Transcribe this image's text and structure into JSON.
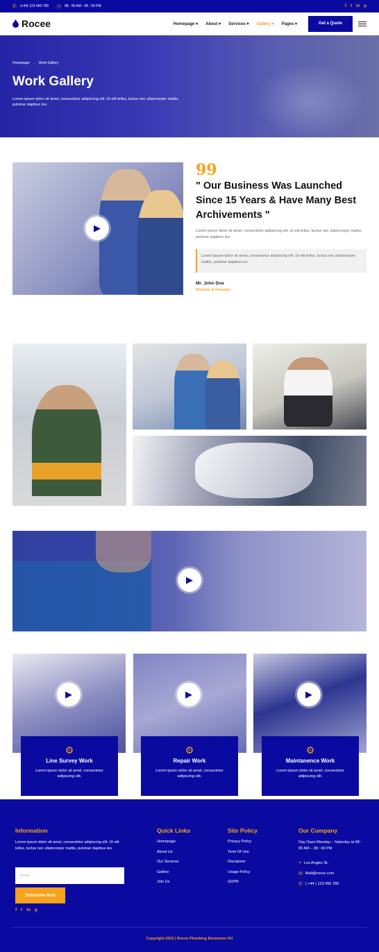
{
  "topbar": {
    "phone": "(+44) 123 456 789",
    "hours": "08 : 00 AM - 08 : 00 PM",
    "social": [
      "f",
      "t",
      "in",
      "p"
    ]
  },
  "nav": {
    "logo": "Rocee",
    "items": [
      "Homepage",
      "About",
      "Services",
      "Gallery",
      "Pages"
    ],
    "active": "Gallery",
    "quote_label": "Get a Quote"
  },
  "hero": {
    "crumb_home": "Homepage",
    "crumb_current": "Work Gallery",
    "title": "Work Gallery",
    "text": "Lorem ipsum dolor sit amet, consectetur adipiscing elit. Ut elit tellus, luctus nec ullamcorper mattis, pulvinar dapibus leo."
  },
  "about": {
    "quote_mark": "99",
    "heading": "\" Our Business Was Launched Since 15 Years & Have Many Best Archivements \"",
    "desc": "Lorem ipsum dolor sit amet, consectetur adipiscing elit. Ut elit tellus, luctus nec ullamcorper mattis, pulvinar dapibus leo.",
    "block": "Lorem ipsum dolor sit amet, consectetur adipiscing elit. Ut elit tellus, luctus nec ullamcorper mattis, pulvinar dapibus leo.",
    "name": "Mr. John Doe",
    "role": "Director & Founder"
  },
  "services": [
    {
      "title": "Line Survey Work",
      "text": "Lorem ipsum dolor sit amet, consectetur adipiscing elit."
    },
    {
      "title": "Repair Work",
      "text": "Lorem ipsum dolor sit amet, consectetur adipiscing elit."
    },
    {
      "title": "Maintanence Work",
      "text": "Lorem ipsum dolor sit amet, consectetur adipiscing elit."
    }
  ],
  "footer": {
    "info_title": "Information",
    "info_text": "Lorem ipsum dolor sit amet, consectetur adipiscing elit. Ut elit tellus, luctus nec ullamcorper mattis, pulvinar dapibus leo.",
    "email_placeholder": "Email",
    "subscribe_label": "Subscribe Now",
    "social": [
      "f",
      "t",
      "in",
      "p"
    ],
    "links_title": "Quick Links",
    "links": [
      "Homepage",
      "About Us",
      "Our Services",
      "Gallery",
      "Join Us"
    ],
    "policy_title": "Site Policy",
    "policy": [
      "Privacy Policy",
      "Term Of Use",
      "Disclaimer",
      "Usage Policy",
      "GDPR"
    ],
    "company_title": "Our Company",
    "company_hours": "Day Open Monday – Saturday at 08 : 00 AM – 08 : 00 PM",
    "address": "Los Angles St.",
    "mail": "Mail@rocee.com",
    "phone": "( +44 ) 123 456 789",
    "copyright": "Copyright 2022 | Rocee Plumbing Elementor Kit"
  }
}
